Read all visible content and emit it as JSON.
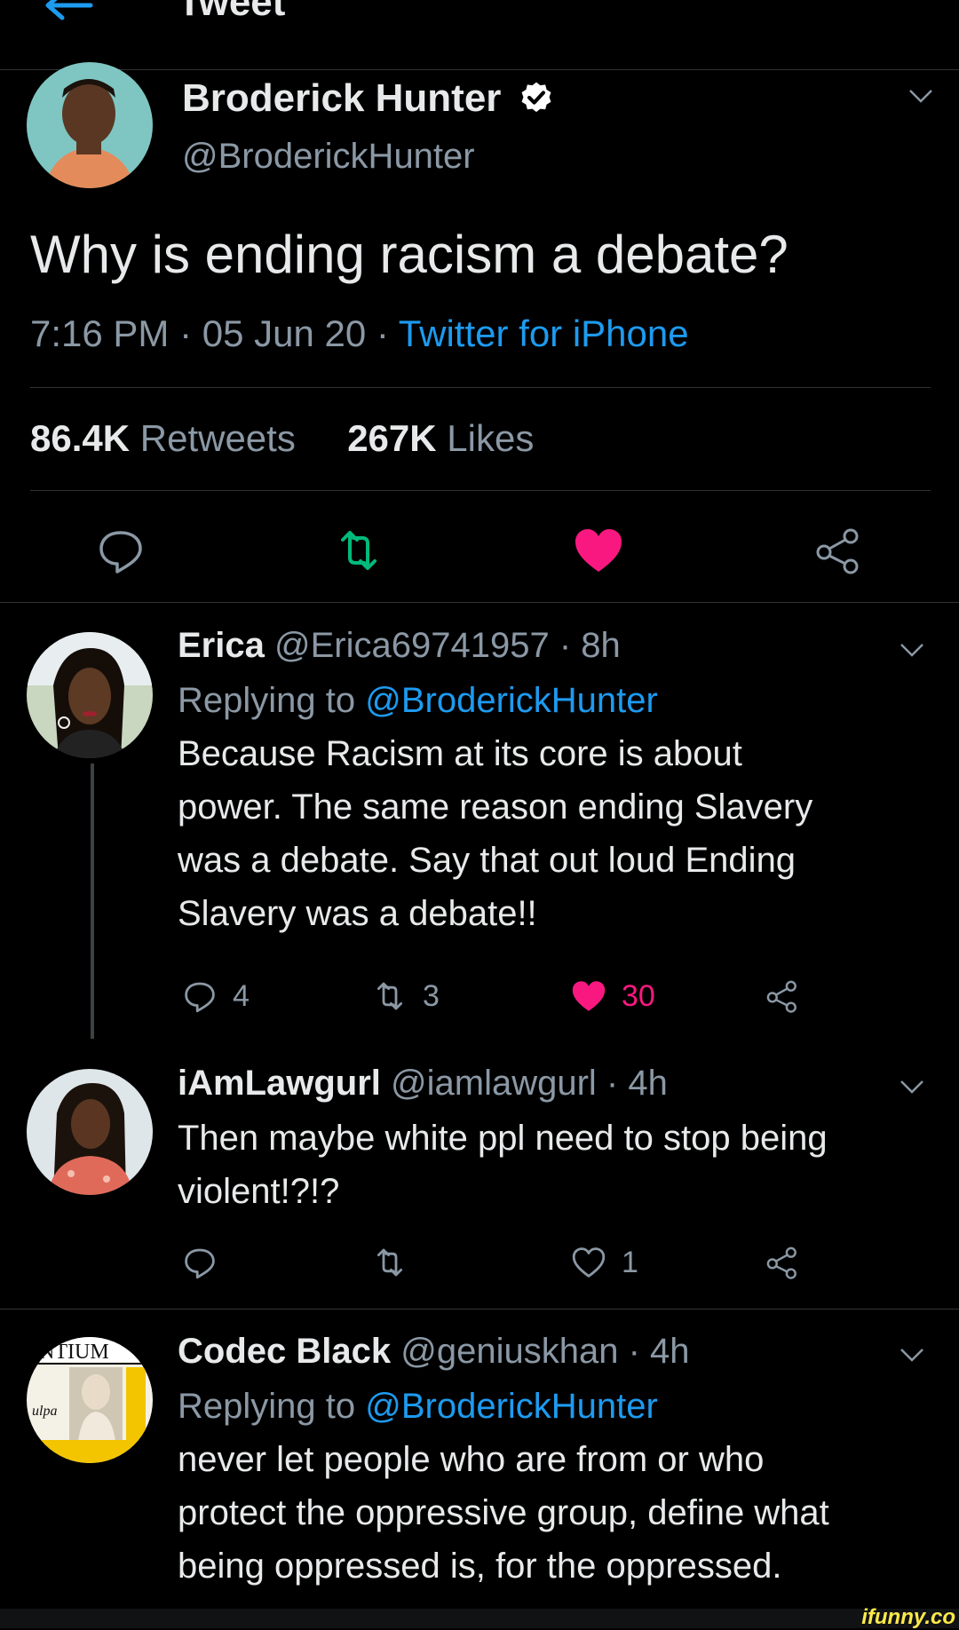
{
  "topbar": {
    "title": "Tweet"
  },
  "main_tweet": {
    "author_name": "Broderick Hunter",
    "author_handle": "@BroderickHunter",
    "text": "Why is ending racism a debate?",
    "time": "7:16 PM · 05 Jun 20 · ",
    "source": "Twitter for iPhone",
    "retweets_count": "86.4K",
    "retweets_label": "Retweets",
    "likes_count": "267K",
    "likes_label": "Likes"
  },
  "replies": [
    {
      "name": "Erica",
      "handle": "@Erica69741957",
      "age": " · 8h",
      "replying_prefix": "Replying to ",
      "replying_to": "@BroderickHunter",
      "lines": [
        "Because Racism at its core is about",
        "power. The same reason ending Slavery",
        "was a debate. Say that out loud Ending",
        "Slavery was a debate!!"
      ],
      "reply_count": "4",
      "retweet_count": "3",
      "like_count": "30"
    },
    {
      "name": "iAmLawgurl",
      "handle": "@iamlawgurl",
      "age": " · 4h",
      "lines": [
        "Then maybe white ppl need to stop being",
        "violent!?!?"
      ],
      "reply_count": "",
      "retweet_count": "",
      "like_count": "1"
    },
    {
      "name": "Codec Black",
      "handle": "@geniuskhan",
      "age": " · 4h",
      "replying_prefix": "Replying to ",
      "replying_to": "@BroderickHunter",
      "lines": [
        "never let people who are from or who",
        "protect the oppressive group, define what",
        "being oppressed is, for the oppressed."
      ]
    }
  ],
  "watermark": "ifunny.co",
  "colors": {
    "accent": "#1d9bf0",
    "retweet": "#00ba7c",
    "like": "#f91880",
    "muted": "#8b98a5"
  }
}
